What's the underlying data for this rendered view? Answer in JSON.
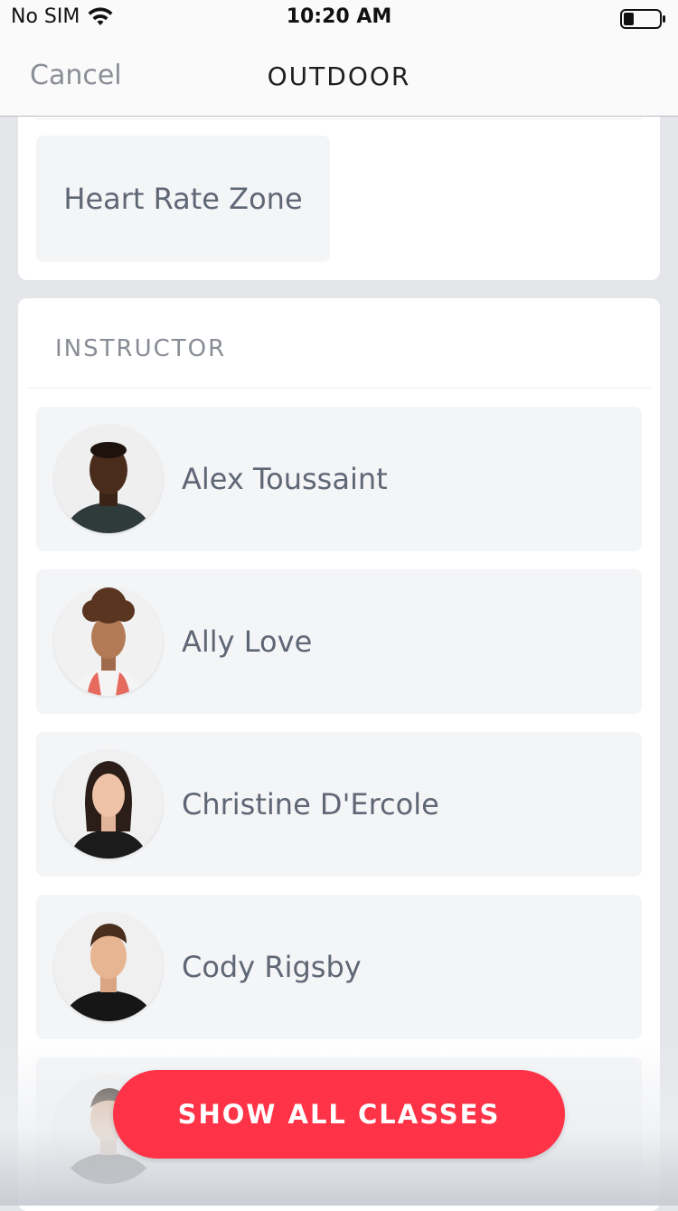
{
  "status_bar": {
    "carrier": "No SIM",
    "time": "10:20 AM",
    "wifi_icon": "wifi-icon",
    "battery_icon": "battery-icon",
    "battery_level": 0.3
  },
  "nav": {
    "cancel_label": "Cancel",
    "title": "OUTDOOR"
  },
  "filters": {
    "chip_label": "Heart Rate Zone"
  },
  "instructor_section": {
    "header": "INSTRUCTOR",
    "instructors": [
      {
        "name": "Alex Toussaint"
      },
      {
        "name": "Ally Love"
      },
      {
        "name": "Christine D'Ercole"
      },
      {
        "name": "Cody Rigsby"
      },
      {
        "name": ""
      }
    ]
  },
  "cta": {
    "label": "SHOW ALL CLASSES",
    "color": "#ff3347"
  }
}
